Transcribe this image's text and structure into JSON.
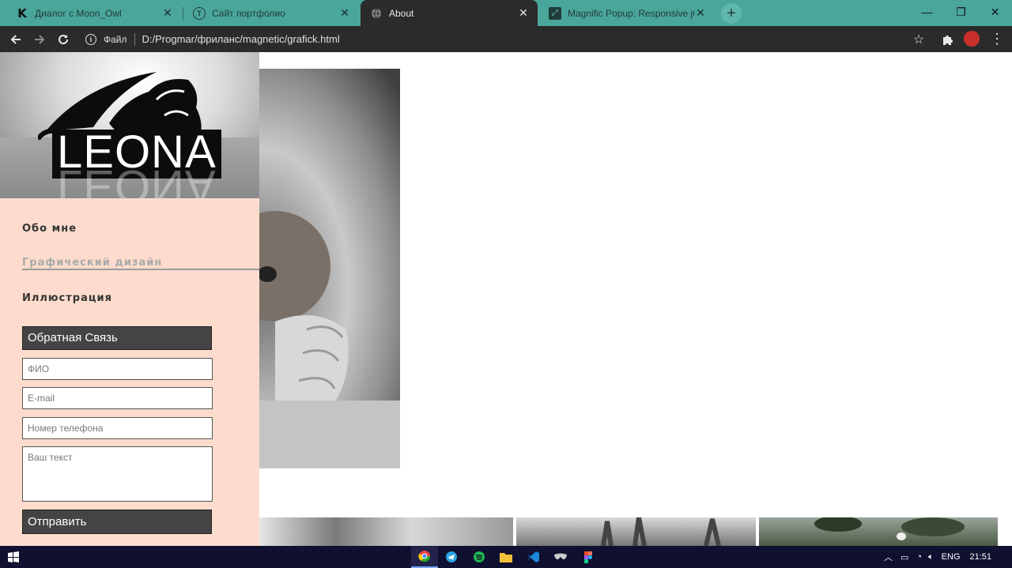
{
  "browser": {
    "tabs": [
      {
        "title": "Диалог с Moon_Owl",
        "icon": "k-logo-icon",
        "active": false
      },
      {
        "title": "Сайт портфолио",
        "icon": "t-logo-icon",
        "active": false
      },
      {
        "title": "About",
        "icon": "globe-icon",
        "active": true
      },
      {
        "title": "Magnific Popup: Responsive jQu",
        "icon": "magnific-logo-icon",
        "active": false
      }
    ],
    "close_glyph": "✕",
    "new_tab_glyph": "+",
    "window_controls": {
      "minimize": "—",
      "maximize": "❐",
      "close": "✕"
    },
    "address_label": "Файл",
    "address_url": "D:/Progmar/фриланс/magnetic/grafick.html"
  },
  "sidebar": {
    "logo_text": "LEONA",
    "nav": {
      "about": "Обо мне",
      "graphic_design": "Графический дизайн",
      "illustration": "Иллюстрация"
    },
    "form": {
      "title": "Обратная Связь",
      "name_placeholder": "ФИО",
      "email_placeholder": "E-mail",
      "phone_placeholder": "Номер телефона",
      "message_placeholder": "Ваш текст",
      "submit_label": "Отправить"
    }
  },
  "taskbar": {
    "language": "ENG",
    "time": "21:51"
  }
}
